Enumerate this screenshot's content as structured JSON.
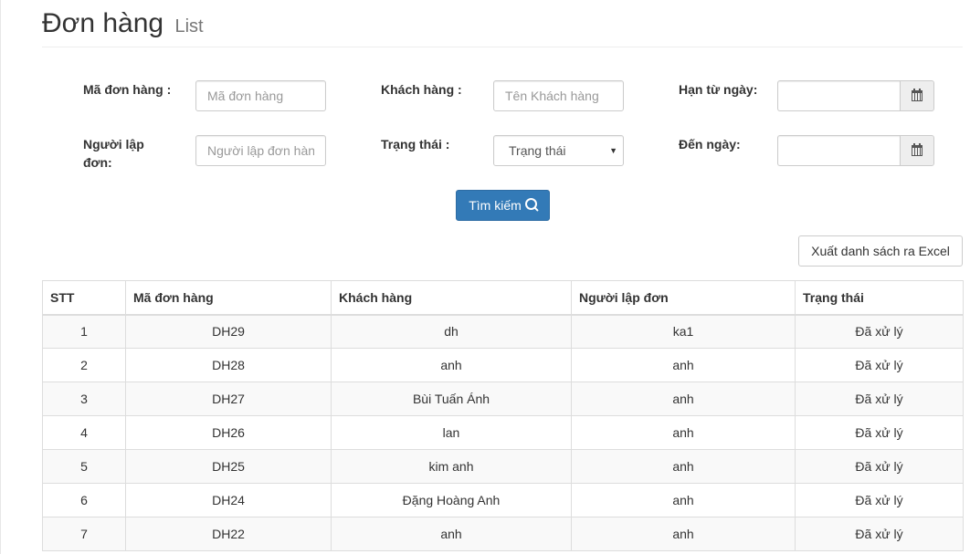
{
  "header": {
    "title": "Đơn hàng",
    "subtitle": "List"
  },
  "filters": {
    "order_code_label": "Mã đơn hàng :",
    "order_code_placeholder": "Mã đơn hàng",
    "customer_label": "Khách hàng :",
    "customer_placeholder": "Tên Khách hàng",
    "from_date_label": "Hạn từ ngày:",
    "creator_label": "Người lập đơn:",
    "creator_placeholder": "Người lập đơn hàng",
    "status_label": "Trạng thái :",
    "status_selected": "Trạng thái",
    "to_date_label": "Đến ngày:",
    "from_date_icon": "calendar-icon",
    "to_date_icon": "calendar-icon"
  },
  "actions": {
    "search_label": "Tìm kiếm",
    "search_icon": "search-icon",
    "export_label": "Xuất danh sách ra Excel"
  },
  "table": {
    "columns": [
      "STT",
      "Mã đơn hàng",
      "Khách hàng",
      "Người lập đơn",
      "Trạng thái"
    ],
    "rows": [
      [
        "1",
        "DH29",
        "dh",
        "ka1",
        "Đã xử lý"
      ],
      [
        "2",
        "DH28",
        "anh",
        "anh",
        "Đã xử lý"
      ],
      [
        "3",
        "DH27",
        "Bùi Tuấn Ánh",
        "anh",
        "Đã xử lý"
      ],
      [
        "4",
        "DH26",
        "lan",
        "anh",
        "Đã xử lý"
      ],
      [
        "5",
        "DH25",
        "kim anh",
        "anh",
        "Đã xử lý"
      ],
      [
        "6",
        "DH24",
        "Đặng Hoàng Anh",
        "anh",
        "Đã xử lý"
      ],
      [
        "7",
        "DH22",
        "anh",
        "anh",
        "Đã xử lý"
      ]
    ]
  },
  "colors": {
    "primary": "#337ab7",
    "stripe": "#f9f9f9",
    "border": "#dddddd"
  }
}
